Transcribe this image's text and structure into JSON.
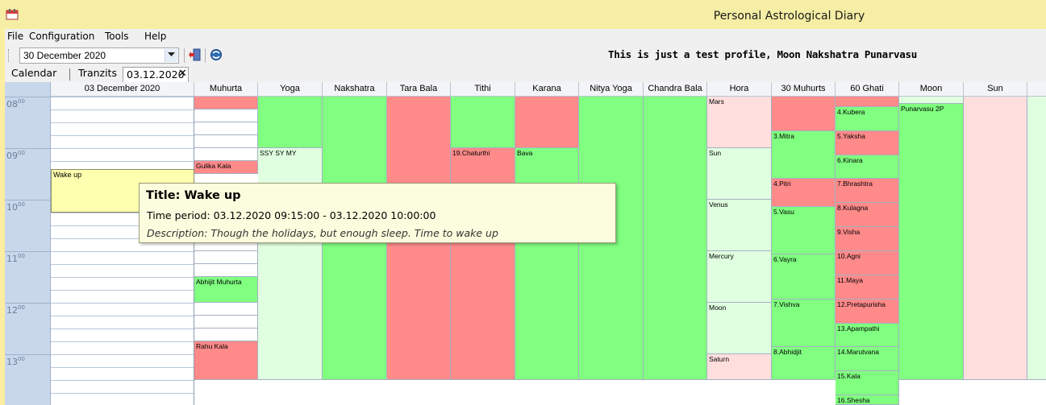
{
  "window": {
    "title": "Personal Astrological Diary"
  },
  "menu": [
    "File",
    "Configuration",
    "Tools",
    "Help"
  ],
  "toolbar": {
    "date_value": "30 December 2020",
    "profile_text": "This is just a test profile, Moon Nakshatra Punarvasu"
  },
  "tabs": [
    "Calendar",
    "Tranzits",
    "03.12.2020"
  ],
  "tab_close": "✕",
  "hours": [
    {
      "h": "08",
      "m": "00"
    },
    {
      "h": "09",
      "m": "00"
    },
    {
      "h": "10",
      "m": "00"
    },
    {
      "h": "11",
      "m": "00"
    },
    {
      "h": "12",
      "m": "00"
    },
    {
      "h": "13",
      "m": "00"
    }
  ],
  "columns": [
    "03 December 2020",
    "Muhurta",
    "Yoga",
    "Nakshatra",
    "Tara Bala",
    "Tithi",
    "Karana",
    "Nitya Yoga",
    "Chandra Bala",
    "Hora",
    "30 Muhurts",
    "60 Ghati",
    "Moon",
    "Sun"
  ],
  "blocks": [
    {
      "col": 1,
      "start": 0,
      "end": 0.25,
      "color": "r",
      "label": ""
    },
    {
      "col": 1,
      "start": 0.25,
      "end": 0.5,
      "color": "w",
      "label": ""
    },
    {
      "col": 1,
      "start": 0.5,
      "end": 0.75,
      "color": "w",
      "label": ""
    },
    {
      "col": 1,
      "start": 0.75,
      "end": 1.0,
      "color": "w",
      "label": ""
    },
    {
      "col": 1,
      "start": 1.0,
      "end": 1.25,
      "color": "w",
      "label": ""
    },
    {
      "col": 1,
      "start": 1.25,
      "end": 1.5,
      "color": "r",
      "label": "Gulika Kala"
    },
    {
      "col": 1,
      "start": 2.0,
      "end": 2.25,
      "color": "w",
      "label": ""
    },
    {
      "col": 1,
      "start": 2.25,
      "end": 2.5,
      "color": "w",
      "label": ""
    },
    {
      "col": 1,
      "start": 2.5,
      "end": 2.75,
      "color": "w",
      "label": ""
    },
    {
      "col": 1,
      "start": 2.75,
      "end": 3.0,
      "color": "w",
      "label": ""
    },
    {
      "col": 1,
      "start": 3.0,
      "end": 3.25,
      "color": "w",
      "label": ""
    },
    {
      "col": 1,
      "start": 3.25,
      "end": 3.5,
      "color": "w",
      "label": ""
    },
    {
      "col": 1,
      "start": 3.5,
      "end": 4.0,
      "color": "g",
      "label": "Abhijit Muhurta"
    },
    {
      "col": 1,
      "start": 4.0,
      "end": 4.25,
      "color": "w",
      "label": ""
    },
    {
      "col": 1,
      "start": 4.25,
      "end": 4.5,
      "color": "w",
      "label": ""
    },
    {
      "col": 1,
      "start": 4.5,
      "end": 4.75,
      "color": "w",
      "label": ""
    },
    {
      "col": 1,
      "start": 4.75,
      "end": 5.5,
      "color": "r",
      "label": "Rahu Kala"
    },
    {
      "col": 2,
      "start": 0,
      "end": 1.0,
      "color": "g",
      "label": ""
    },
    {
      "col": 2,
      "start": 1.0,
      "end": 5.5,
      "color": "lg",
      "label": "SSY SY MY"
    },
    {
      "col": 3,
      "start": 0,
      "end": 5.5,
      "color": "g",
      "label": ""
    },
    {
      "col": 4,
      "start": 0,
      "end": 5.5,
      "color": "r",
      "label": ""
    },
    {
      "col": 5,
      "start": 0,
      "end": 1.0,
      "color": "g",
      "label": ""
    },
    {
      "col": 5,
      "start": 1.0,
      "end": 5.5,
      "color": "r",
      "label": "19.Chaturthi"
    },
    {
      "col": 6,
      "start": 0,
      "end": 1.0,
      "color": "r",
      "label": ""
    },
    {
      "col": 6,
      "start": 1.0,
      "end": 5.5,
      "color": "g",
      "label": "Bava"
    },
    {
      "col": 7,
      "start": 0,
      "end": 5.5,
      "color": "g",
      "label": ""
    },
    {
      "col": 8,
      "start": 0,
      "end": 5.5,
      "color": "g",
      "label": ""
    },
    {
      "col": 9,
      "start": 0,
      "end": 1.0,
      "color": "lr",
      "label": "Mars"
    },
    {
      "col": 9,
      "start": 1.0,
      "end": 2.0,
      "color": "lg",
      "label": "Sun"
    },
    {
      "col": 9,
      "start": 2.0,
      "end": 3.0,
      "color": "lg",
      "label": "Venus"
    },
    {
      "col": 9,
      "start": 3.0,
      "end": 4.0,
      "color": "lg",
      "label": "Mercury"
    },
    {
      "col": 9,
      "start": 4.0,
      "end": 5.0,
      "color": "lg",
      "label": "Moon"
    },
    {
      "col": 9,
      "start": 5.0,
      "end": 5.5,
      "color": "lr",
      "label": "Saturn"
    },
    {
      "col": 10,
      "start": 0,
      "end": 0.667,
      "color": "r",
      "label": ""
    },
    {
      "col": 10,
      "start": 0.667,
      "end": 1.6,
      "color": "g",
      "label": "3.Mitra"
    },
    {
      "col": 10,
      "start": 1.6,
      "end": 2.133,
      "color": "r",
      "label": "4.Pitri"
    },
    {
      "col": 10,
      "start": 2.133,
      "end": 3.067,
      "color": "g",
      "label": "5.Vasu"
    },
    {
      "col": 10,
      "start": 3.067,
      "end": 3.933,
      "color": "g",
      "label": "6.Vayra"
    },
    {
      "col": 10,
      "start": 3.933,
      "end": 4.867,
      "color": "g",
      "label": "7.Vishva"
    },
    {
      "col": 10,
      "start": 4.867,
      "end": 5.5,
      "color": "g",
      "label": "8.Abhidjit"
    },
    {
      "col": 11,
      "start": 0,
      "end": 0.2,
      "color": "r",
      "label": ""
    },
    {
      "col": 11,
      "start": 0.2,
      "end": 0.667,
      "color": "g",
      "label": "4.Kubera"
    },
    {
      "col": 11,
      "start": 0.667,
      "end": 1.133,
      "color": "r",
      "label": "5.Yaksha"
    },
    {
      "col": 11,
      "start": 1.133,
      "end": 1.6,
      "color": "g",
      "label": "6.Kinara"
    },
    {
      "col": 11,
      "start": 1.6,
      "end": 2.067,
      "color": "r",
      "label": "7.Bhrashtra"
    },
    {
      "col": 11,
      "start": 2.067,
      "end": 2.533,
      "color": "r",
      "label": "8.Kulagna"
    },
    {
      "col": 11,
      "start": 2.533,
      "end": 3.0,
      "color": "r",
      "label": "9.Visha"
    },
    {
      "col": 11,
      "start": 3.0,
      "end": 3.467,
      "color": "r",
      "label": "10.Agni"
    },
    {
      "col": 11,
      "start": 3.467,
      "end": 3.933,
      "color": "r",
      "label": "11.Maya"
    },
    {
      "col": 11,
      "start": 3.933,
      "end": 4.4,
      "color": "r",
      "label": "12.Pretapurisha"
    },
    {
      "col": 11,
      "start": 4.4,
      "end": 4.867,
      "color": "g",
      "label": "13.Apampathi"
    },
    {
      "col": 11,
      "start": 4.867,
      "end": 5.333,
      "color": "g",
      "label": "14.Marutvana"
    },
    {
      "col": 11,
      "start": 5.333,
      "end": 5.8,
      "color": "g",
      "label": "15.Kala"
    },
    {
      "col": 11,
      "start": 5.8,
      "end": 6.267,
      "color": "g",
      "label": "16.Shesha"
    },
    {
      "col": 12,
      "start": 0,
      "end": 0.133,
      "color": "lg",
      "label": ""
    },
    {
      "col": 12,
      "start": 0.133,
      "end": 5.5,
      "color": "g",
      "label": "Punarvasu 2P"
    },
    {
      "col": 13,
      "start": 0,
      "end": 5.5,
      "color": "lr",
      "label": ""
    },
    {
      "col": 14,
      "start": 0,
      "end": 5.5,
      "color": "lg",
      "label": ""
    }
  ],
  "event": {
    "label": "Wake up"
  },
  "tooltip": {
    "title": "Title: Wake up",
    "time": "Time period: 03.12.2020 09:15:00 - 03.12.2020 10:00:00",
    "description": "Description: Though the holidays, but enough sleep. Time to wake up"
  }
}
